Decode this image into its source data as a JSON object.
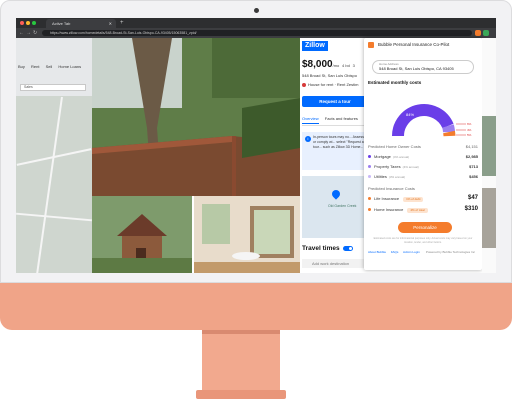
{
  "browser": {
    "tab_title": "Active Tab",
    "new_tab": "+",
    "url": "https://www.zillow.com/homedetails/548-Broad-St-San-Luis-Obispo-CA-93405/15063581_zpid/"
  },
  "left_nav": {
    "links": [
      "Buy",
      "Rent",
      "Sell",
      "Home Loans"
    ],
    "search_value": "Sales"
  },
  "zillow": {
    "logo": "Zillow",
    "price": "$8,000",
    "price_suffix": "/mo",
    "beds": "4 bd",
    "baths": "3",
    "address": "548 Broad St, San Luis Obispo",
    "status": "House for rent",
    "zestimate": "Rent Zestim",
    "tour_button": "Request a tour",
    "tab_overview": "Overview",
    "tab_facts": "Facts and features",
    "info_text": "In-person tours may no... Assessing or comply wi... select \"Request a tour... such as Zillow 3D Home...",
    "map_label": "Old Garden Creek",
    "travel_times": "Travel times",
    "destination_placeholder": "Add work destination"
  },
  "bubble": {
    "title": "Bubble Personal Insurance Co-Pilot",
    "address_label": "Home Address",
    "address_value": "548 Broad St, San Luis Obispo, CA 93405",
    "estimated_label": "Estimated monthly costs",
    "donut_pct_main": "84%",
    "donut_pct_a": "6%",
    "donut_pct_b": "4%",
    "donut_pct_c": "5%",
    "predicted_home_label": "Predicted Home Owner Costs",
    "predicted_home_total": "$4,151",
    "mortgage_label": "Mortgage",
    "mortgage_sub": "(4% annual)",
    "mortgage_amt": "$2,985",
    "tax_label": "Property Taxes",
    "tax_sub": "(4% annual)",
    "tax_amt": "$713",
    "util_label": "Utilities",
    "util_sub": "(3% annual)",
    "util_amt": "$456",
    "predicted_ins_label": "Predicted Insurance Costs",
    "life_label": "Life Insurance",
    "life_pill": "1% of debt",
    "life_amt": "$47",
    "home_label": "Home Insurance",
    "home_pill": "4% of total",
    "home_amt": "$310",
    "personalize_button": "Personalize",
    "disclaimer": "Estimated costs are for informational purposes only. Actual costs may vary based on your location, lender, and other factors.",
    "foot_links": [
      "About Bubble",
      "FAQs",
      "Admin Login"
    ],
    "powered_by": "Powered by Bubble Technologies Inc"
  },
  "colors": {
    "zillow_blue": "#006aff",
    "bubble_orange": "#f47c2c",
    "donut_purple": "#6a3ee8",
    "chin_peach": "#f0a488"
  }
}
